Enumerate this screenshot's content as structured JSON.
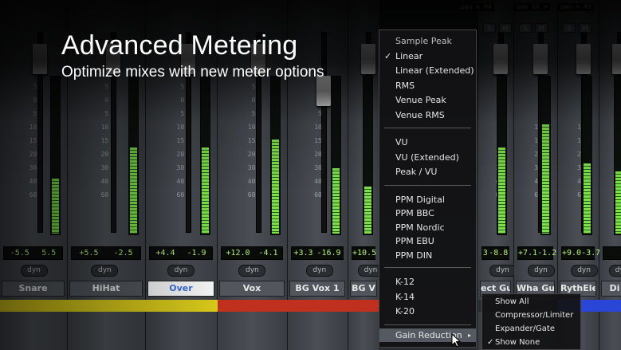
{
  "headline": "Advanced Metering",
  "subheadline": "Optimize mixes with new meter options",
  "tracks": [
    {
      "name": "Snare",
      "peak_left": "-5.5",
      "peak_right": "5.5",
      "color": "#d7c81a",
      "selected": false
    },
    {
      "name": "HiHat",
      "peak_left": "+5.5",
      "peak_right": "-2.5",
      "color": "#d7c81a",
      "selected": false
    },
    {
      "name": "Over",
      "peak_left": "+4.4",
      "peak_right": "-1.9",
      "color": "#d7c81a",
      "selected": true
    },
    {
      "name": "Vox",
      "peak_left": "+12.0",
      "peak_right": "-4.1",
      "color": "#c0301e",
      "selected": false
    },
    {
      "name": "BG Vox 1",
      "peak_left": "+3.3",
      "peak_right": "-16.9",
      "color": "#c0301e",
      "selected": false
    },
    {
      "name": "BG V",
      "peak_left": "+10.5",
      "peak_right": "",
      "color": "#c0301e",
      "selected": false
    },
    {
      "name": "ect Guit",
      "peak_left": "3",
      "peak_right": "-8.8",
      "color": "#2b2e32",
      "selected": false
    },
    {
      "name": "Wha Guit",
      "peak_left": "+7.1",
      "peak_right": "-1.2",
      "color": "#2b2e32",
      "selected": false
    },
    {
      "name": "RythElecGt",
      "peak_left": "+9.0",
      "peak_right": "-3.7",
      "color": "#2a46d6",
      "selected": false
    },
    {
      "name": "Di",
      "peak_left": "",
      "peak_right": "",
      "color": "#2a46d6",
      "selected": false
    }
  ],
  "pan_values": [
    "pan < 60",
    "pan 60 >",
    "pan > 49"
  ],
  "dyn_label": "dyn",
  "solo_label": "S",
  "mute_label": "M",
  "scale_ticks": [
    "5",
    "0",
    "5",
    "10",
    "15",
    "20",
    "30",
    "40",
    "60"
  ],
  "menu": {
    "group1": [
      {
        "label": "Sample Peak",
        "checked": false,
        "dim": true
      },
      {
        "label": "Linear",
        "checked": true
      },
      {
        "label": "Linear (Extended)",
        "checked": false
      },
      {
        "label": "RMS",
        "checked": false
      },
      {
        "label": "Venue Peak",
        "checked": false
      },
      {
        "label": "Venue RMS",
        "checked": false
      }
    ],
    "group2": [
      {
        "label": "VU"
      },
      {
        "label": "VU (Extended)"
      },
      {
        "label": "Peak / VU"
      }
    ],
    "group3": [
      {
        "label": "PPM Digital"
      },
      {
        "label": "PPM BBC"
      },
      {
        "label": "PPM Nordic"
      },
      {
        "label": "PPM EBU"
      },
      {
        "label": "PPM DIN"
      }
    ],
    "group4": [
      {
        "label": "K-12"
      },
      {
        "label": "K-14"
      },
      {
        "label": "K-20"
      }
    ],
    "gain_reduction": {
      "label": "Gain Reduction",
      "arrow": "▸"
    },
    "check_glyph": "✓"
  },
  "submenu": [
    {
      "label": "Show All",
      "checked": false
    },
    {
      "label": "Compressor/Limiter",
      "checked": false
    },
    {
      "label": "Expander/Gate",
      "checked": false
    },
    {
      "label": "Show None",
      "checked": true
    }
  ],
  "meter_levels": [
    0.35,
    0.55,
    0.55,
    0.6,
    0.42,
    0.3,
    0.55,
    0.7,
    0.45,
    0.4
  ]
}
